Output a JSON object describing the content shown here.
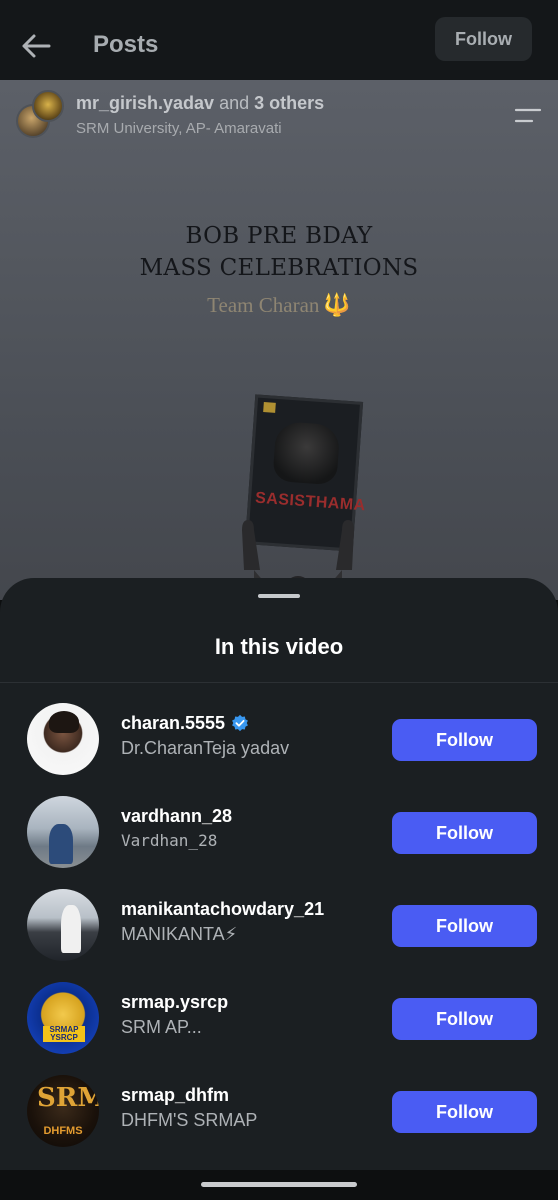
{
  "header": {
    "title": "Posts",
    "follow_label": "Follow"
  },
  "post": {
    "author": "mr_girish.yadav",
    "author_suffix_and": "and",
    "author_others": "3 others",
    "location": "SRM University, AP- Amaravati",
    "headline_line1": "BOB PRE BDAY",
    "headline_line2": "MASS CELEBRATIONS",
    "team": "Team Charan",
    "poster_text": "SASISTHAMA"
  },
  "sheet": {
    "title": "In this video",
    "people": [
      {
        "username": "charan.5555",
        "full_name": "Dr.CharanTeja yadav",
        "verified": true,
        "button": "Follow"
      },
      {
        "username": "vardhann_28",
        "full_name": "Vardhan_28",
        "verified": false,
        "button": "Follow"
      },
      {
        "username": "manikantachowdary_21",
        "full_name": "MANIKANTA⚡",
        "verified": false,
        "button": "Follow"
      },
      {
        "username": "srmap.ysrcp",
        "full_name": "SRM AP...",
        "verified": false,
        "button": "Follow",
        "avatar_text": "SRMAP YSRCP"
      },
      {
        "username": "srmap_dhfm",
        "full_name": "DHFM'S SRMAP",
        "verified": false,
        "button": "Follow",
        "avatar_text_1": "SRM",
        "avatar_text_2": "DHFMS"
      }
    ]
  },
  "colors": {
    "follow_button": "#4a5cf3",
    "verified": "#3897f0",
    "sheet_bg": "#1b1f22"
  }
}
